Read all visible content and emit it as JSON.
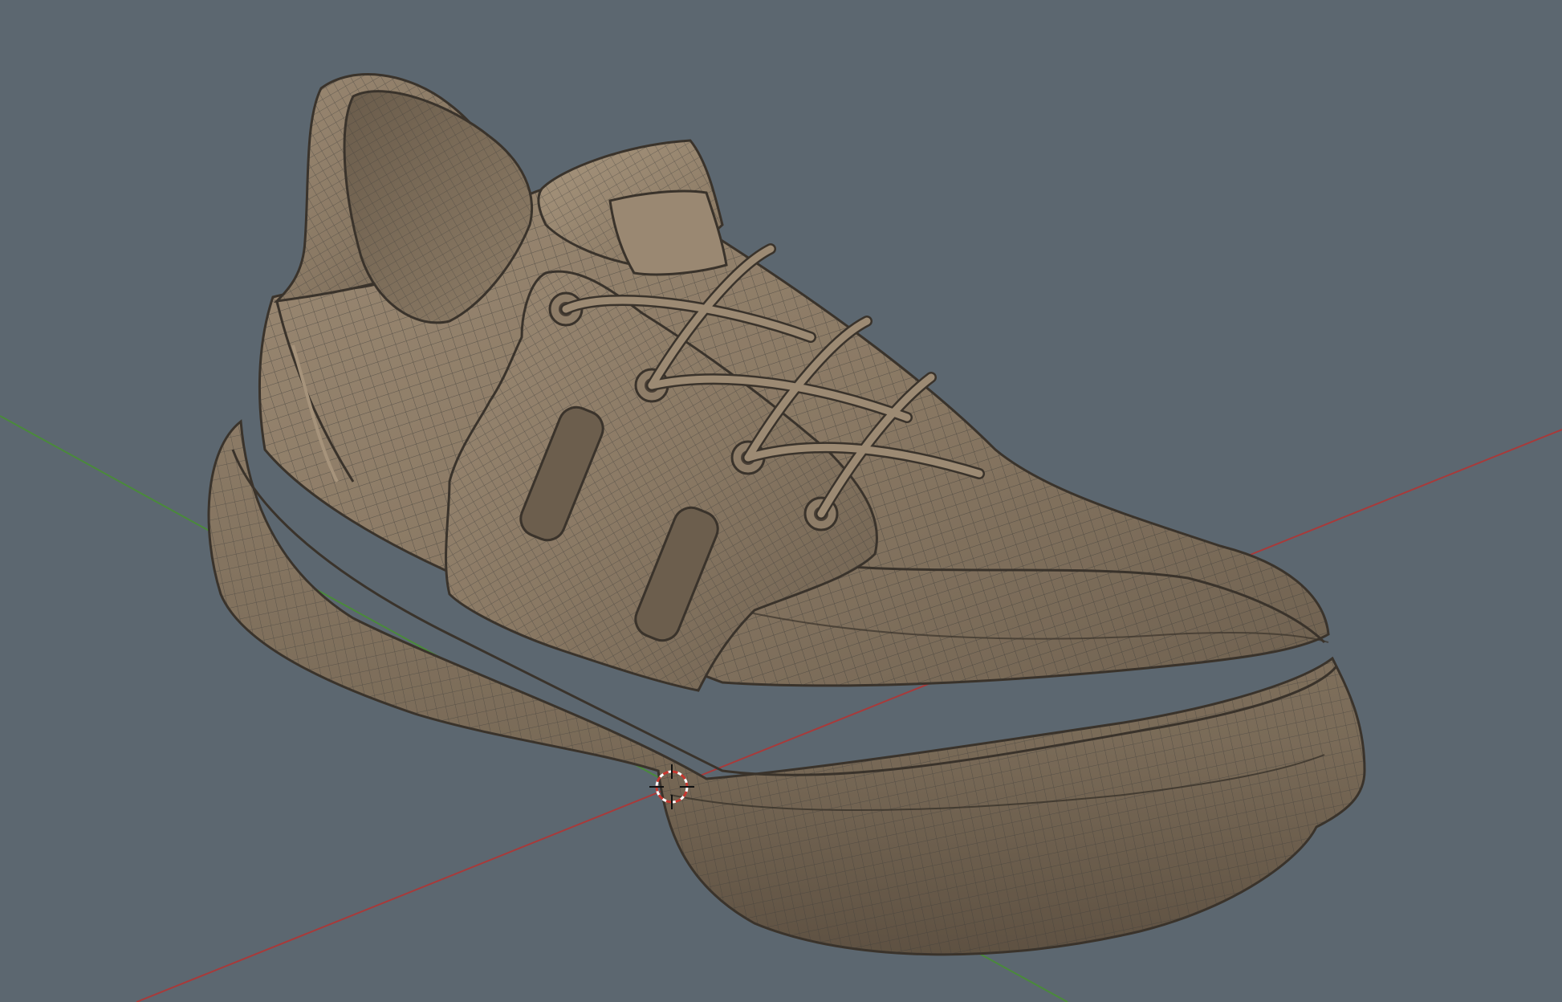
{
  "viewport": {
    "background": "#5c6770",
    "x_axis_color": "#a83a3a",
    "y_axis_color": "#4a8a3a",
    "cursor_color": "#c8372f",
    "model": {
      "fill_base": "#857561",
      "fill_light": "#a5927a",
      "fill_dark": "#5e5142",
      "wire_color": "#3b3a38"
    },
    "icons": [
      "3d-cursor-icon"
    ]
  }
}
